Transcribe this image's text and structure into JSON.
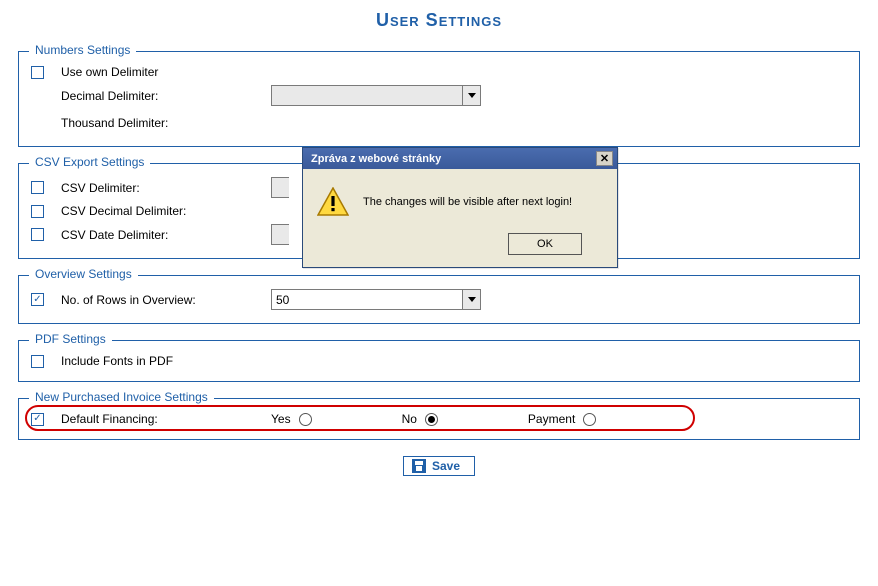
{
  "page_title": "User Settings",
  "sections": {
    "numbers": {
      "legend": "Numbers Settings",
      "use_own_delimiter": {
        "label": "Use own Delimiter",
        "checked": false
      },
      "decimal": {
        "label": "Decimal Delimiter:",
        "value": ""
      },
      "thousand": {
        "label": "Thousand Delimiter:",
        "value": ""
      }
    },
    "csv": {
      "legend": "CSV Export Settings",
      "delimiter": {
        "label": "CSV Delimiter:",
        "checked": false
      },
      "decimal": {
        "label": "CSV Decimal Delimiter:",
        "checked": false
      },
      "date": {
        "label": "CSV Date Delimiter:",
        "checked": false
      }
    },
    "overview": {
      "legend": "Overview Settings",
      "rows": {
        "label": "No. of Rows in Overview:",
        "checked": true,
        "value": "50"
      }
    },
    "pdf": {
      "legend": "PDF Settings",
      "include_fonts": {
        "label": "Include Fonts in PDF",
        "checked": false
      }
    },
    "npi": {
      "legend": "New Purchased Invoice Settings",
      "default_financing": {
        "label": "Default Financing:",
        "checked": true,
        "options": {
          "yes": "Yes",
          "no": "No",
          "payment": "Payment"
        },
        "selected": "no"
      }
    }
  },
  "dialog": {
    "title": "Zpráva z webové stránky",
    "message": "The changes will be visible after next login!",
    "ok": "OK"
  },
  "save_label": "Save"
}
